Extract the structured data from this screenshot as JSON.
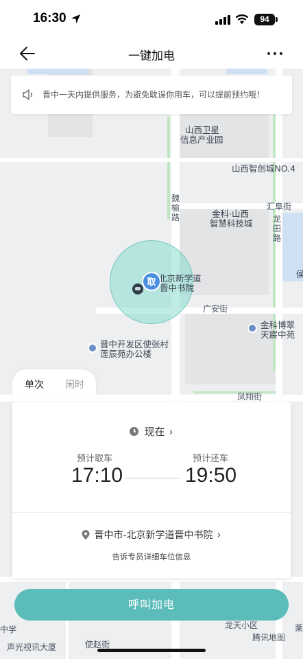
{
  "status_bar": {
    "time": "16:30",
    "battery": "94"
  },
  "nav": {
    "title": "一键加电"
  },
  "notice": {
    "text": "晋中一天内提供服务，为避免耽误你用车，可以提前预约哦！"
  },
  "map": {
    "labels": {
      "l1": "山西卫星",
      "l2": "信息产业园",
      "l3": "山西智创城NO.4",
      "l4": "魏",
      "l5": "榆",
      "l6": "路",
      "l7": "金科·山西",
      "l8": "智慧科技城",
      "l9": "汇阜街",
      "l10": "龙",
      "l11": "田",
      "l12": "路",
      "l13": "北京新学道",
      "l14": "晋中书院",
      "l15": "广安街",
      "l16": "金科博翠",
      "l17": "天宸中苑",
      "l18": "晋中开发区使张村",
      "l19": "莲辰苑办公楼",
      "l20": "凤翔街",
      "l21": "中学",
      "l22": "声光视讯大厦",
      "l23": "使赵街",
      "l24": "龙天小区",
      "l25": "腾讯地图",
      "l26": "侯",
      "l27": "莱"
    },
    "pickup_marker": "取",
    "colors": {
      "radius": "#70d6c8",
      "pin": "#4b8fe0"
    }
  },
  "mode_tabs": {
    "single": "单次",
    "leisure": "闲时"
  },
  "booking": {
    "when_label": "现在",
    "pickup_label": "预计取车",
    "pickup_time": "17:10",
    "return_label": "预计还车",
    "return_time": "19:50",
    "location": "晋中市-北京新学道晋中书院",
    "location_hint": "告诉专员详细车位信息"
  },
  "call_button": {
    "label": "呼叫加电",
    "color": "#5bbcba"
  },
  "icons": [
    "location-arrow-icon",
    "signal-icon",
    "wifi-icon",
    "back-arrow-icon",
    "more-icon",
    "speaker-icon",
    "clock-icon",
    "chevron-right-icon",
    "location-pin-icon",
    "car-icon"
  ]
}
